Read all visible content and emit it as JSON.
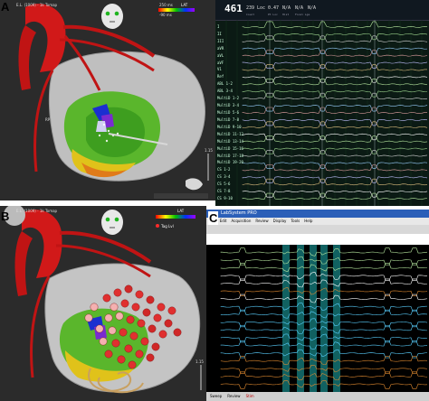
{
  "figure_labels": {
    "a": "A",
    "b": "B",
    "c": "C"
  },
  "panel_a": {
    "legend_unit": "LAT",
    "legend_top": "250 ms",
    "legend_bottom": "-90 ms",
    "map_title": "E.L. (1009) - 1k Tomap",
    "rp_label": "RP",
    "scale_value": "1.15"
  },
  "ecg_panel": {
    "window_value": "461",
    "stats": [
      "239 Loc",
      "0.47",
      "N/A",
      "N/A",
      "N/A"
    ],
    "stat_labels": [
      "Count",
      "Pt Loc",
      "Hist",
      "Focal Lge"
    ],
    "channels": [
      "I",
      "II",
      "III",
      "aVR",
      "aVL",
      "aVF",
      "V1",
      "Ref",
      "ABL 1-2",
      "ABL 3-4",
      "MultiD 1-2",
      "MultiD 3-4",
      "MultiD 5-6",
      "MultiD 7-8",
      "MultiD 9-10",
      "MultiD 11-12",
      "MultiD 13-14",
      "MultiD 15-16",
      "MultiD 17-18",
      "MultiD 19-20",
      "CS 1-2",
      "CS 3-4",
      "CS 5-6",
      "CS 7-8",
      "CS 9-10"
    ]
  },
  "panel_b": {
    "legend_unit": "LAT",
    "map_title": "E.L. (1009) - 1k Tomap",
    "tag_label": "Tag Lvl",
    "scale_value": "1.15"
  },
  "panel_c": {
    "window_title": "LabSystem PRO",
    "menu": [
      "File",
      "Edit",
      "Acquisition",
      "Review",
      "Display",
      "Tools",
      "Help"
    ],
    "status": [
      "Sweep",
      "Review",
      "Stim"
    ]
  },
  "colors": {
    "ecg_bg": "#0b1a14",
    "map_bg": "#2b2b2b",
    "aorta": "#d11919",
    "grid": "#1e4a2e"
  }
}
